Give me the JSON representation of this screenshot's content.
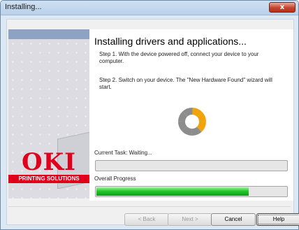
{
  "window": {
    "title": "Installing...",
    "close_label": "x"
  },
  "sidebar": {
    "brand": "OKI",
    "tagline": "PRINTING SOLUTIONS",
    "accent": "#e0001b"
  },
  "main": {
    "heading": "Installing drivers and applications...",
    "step1": "Step 1. With the device powered off, connect your device to your computer.",
    "step2": "Step 2. Switch on your device. The \"New Hardware Found\" wizard will start.",
    "current_task_label": "Current Task: Waiting...",
    "current_task_progress": 0,
    "overall_label": "Overall Progress",
    "overall_progress": 0.8,
    "progress_color": "#23c72b"
  },
  "buttons": {
    "back": "< Back",
    "next": "Next >",
    "cancel": "Cancel",
    "help": "Help"
  }
}
